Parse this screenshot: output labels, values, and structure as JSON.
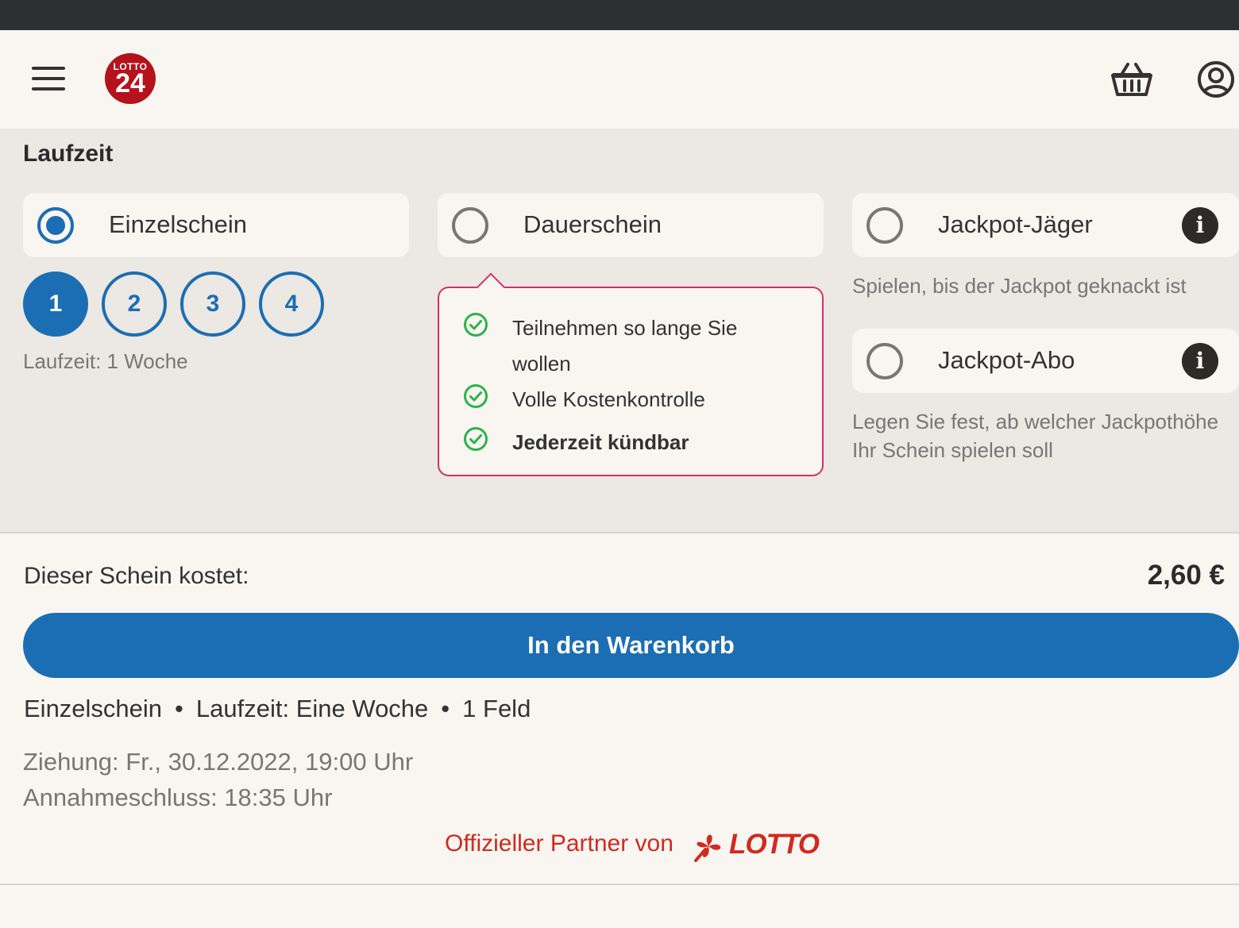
{
  "header": {
    "logo_small": "LOTTO",
    "logo_big": "24"
  },
  "section": {
    "title": "Laufzeit",
    "options": [
      {
        "label": "Einzelschein",
        "selected": true
      },
      {
        "label": "Dauerschein",
        "selected": false
      },
      {
        "label": "Jackpot-Jäger",
        "selected": false
      },
      {
        "label": "Jackpot-Abo",
        "selected": false
      }
    ],
    "weeks": [
      "1",
      "2",
      "3",
      "4"
    ],
    "selected_week": "1",
    "duration_note": "Laufzeit: 1 Woche",
    "jaeger_desc": "Spielen, bis der Jackpot geknackt ist",
    "abo_desc_line1": "Legen Sie fest, ab welcher Jackpothöhe",
    "abo_desc_line2": "Ihr Schein spielen soll",
    "info_icon_glyph": "i"
  },
  "tooltip": {
    "item1_line1": "Teilnehmen so lange Sie",
    "item1_line2": "wollen",
    "item2": "Volle Kostenkontrolle",
    "item3": "Jederzeit kündbar"
  },
  "footer": {
    "cost_label": "Dieser Schein kostet:",
    "cost_value": "2,60 €",
    "cart_button": "In den Warenkorb",
    "summary": [
      "Einzelschein",
      "Laufzeit: Eine Woche",
      "1 Feld"
    ],
    "summary_separator": "•",
    "draw": "Ziehung: Fr., 30.12.2022, 19:00 Uhr",
    "deadline": "Annahmeschluss: 18:35 Uhr",
    "partner_text": "Offizieller Partner von",
    "partner_logo": "LOTTO"
  },
  "colors": {
    "primary": "#1b6eb3",
    "brand_red": "#b5121b",
    "tooltip_border": "#d2316a",
    "check_green": "#2bb34a",
    "statusbar": "#2e2f33"
  }
}
